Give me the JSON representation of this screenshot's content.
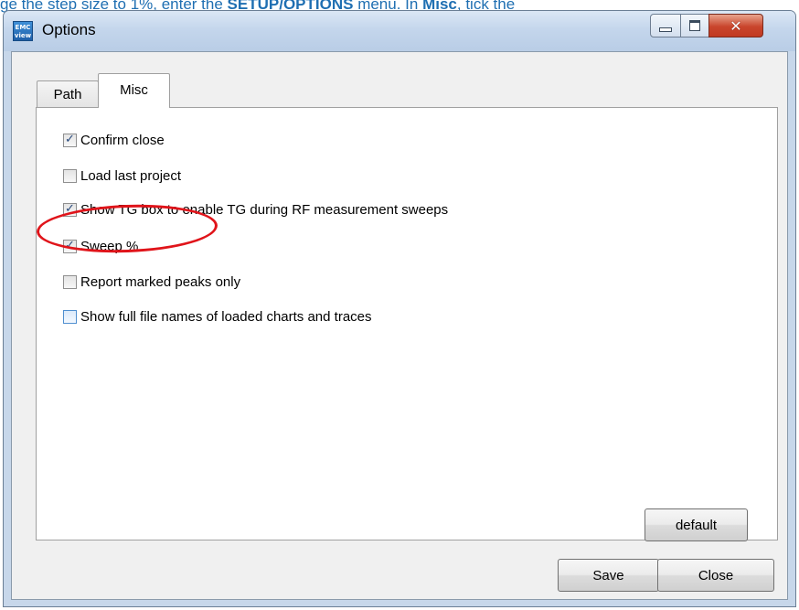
{
  "background_instruction": {
    "prefix": "ge the step size to 1%, enter the ",
    "menu_name": "SETUP/OPTIONS",
    "middle": " menu. In ",
    "tab_name": "Misc",
    "suffix": ", tick the"
  },
  "window": {
    "title": "Options",
    "app_icon_text_top": "EMC",
    "app_icon_text_bottom": "view",
    "controls": {
      "minimize": "minimize-icon",
      "maximize": "maximize-icon",
      "close": "✕"
    }
  },
  "tabs": [
    {
      "label": "Path",
      "selected": false
    },
    {
      "label": "Misc",
      "selected": true
    }
  ],
  "options": [
    {
      "label": "Confirm close",
      "checked": true
    },
    {
      "label": "Load last project",
      "checked": false
    },
    {
      "label": "Show TG box to enable TG during RF measurement sweeps",
      "checked": true
    },
    {
      "label": "Sweep %",
      "checked": true
    },
    {
      "label": "Report marked peaks only",
      "checked": false
    },
    {
      "label": "Show full file names of loaded charts and traces",
      "checked": false,
      "focused": true
    }
  ],
  "buttons": {
    "default_label": "default",
    "save_label": "Save",
    "close_label": "Close"
  },
  "colors": {
    "highlight_ellipse": "#e0141a",
    "instruction_text": "#1f6fb2",
    "checkmark": "#26487a"
  }
}
